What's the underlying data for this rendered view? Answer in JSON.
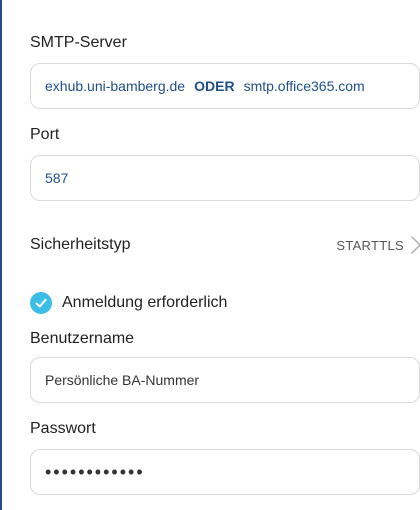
{
  "smtp_server": {
    "label": "SMTP-Server",
    "host_primary": "exhub.uni-bamberg.de",
    "separator": "ODER",
    "host_alternative": "smtp.office365.com"
  },
  "port": {
    "label": "Port",
    "value": "587"
  },
  "security": {
    "label": "Sicherheitstyp",
    "value": "STARTTLS",
    "chevron_icon": "chevron-right-icon"
  },
  "auth_required": {
    "label": "Anmeldung erforderlich",
    "checked": true,
    "icon": "check-circle-icon",
    "color": "#3bbde8"
  },
  "username": {
    "label": "Benutzername",
    "value": "Persönliche BA-Nummer"
  },
  "password": {
    "label": "Passwort",
    "value": "••••••••••••"
  },
  "colors": {
    "accent_text": "#1f4f8a",
    "check": "#3bbde8",
    "border": "#d9d9d9"
  }
}
